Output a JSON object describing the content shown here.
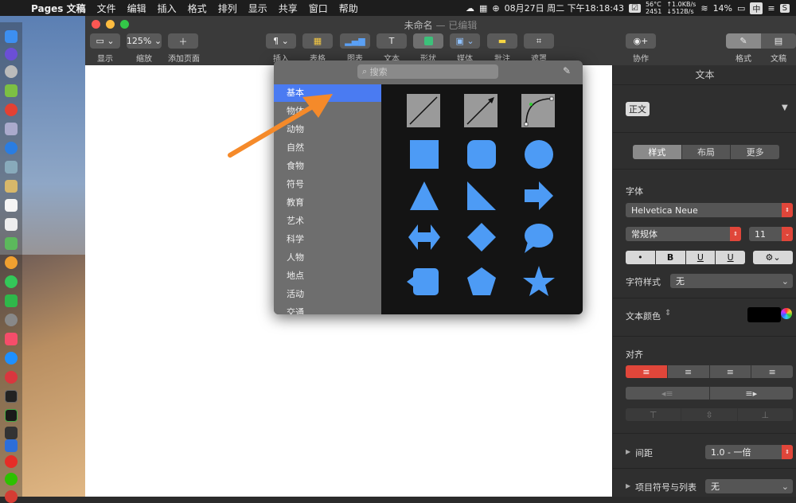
{
  "menubar": {
    "app_name": "Pages 文稿",
    "menus": [
      "文件",
      "编辑",
      "插入",
      "格式",
      "排列",
      "显示",
      "共享",
      "窗口",
      "帮助"
    ],
    "datetime": "08月27日 周二 下午18:18:43",
    "cpu_temp": "56°C",
    "fan": "2451",
    "net_up": "↑1.0KB/s",
    "net_down": "↓512B/s",
    "battery": "14%",
    "input_method": "中"
  },
  "window": {
    "title": "未命名",
    "subtitle": "— 已编辑",
    "traffic_colors": [
      "#fc5753",
      "#fdbc40",
      "#33c748"
    ]
  },
  "toolbar": {
    "view_label": "显示",
    "zoom_value": "125%",
    "zoom_label": "缩放",
    "add_page_label": "添加页面",
    "insert_label": "插入",
    "table_label": "表格",
    "chart_label": "图表",
    "text_label": "文本",
    "shape_label": "形状",
    "media_label": "媒体",
    "comment_label": "批注",
    "crop_label": "遮罩",
    "collab_label": "协作",
    "format_label": "格式",
    "document_label": "文稿"
  },
  "popover": {
    "search_placeholder": "搜索",
    "categories": [
      "基本",
      "物体",
      "动物",
      "自然",
      "食物",
      "符号",
      "教育",
      "艺术",
      "科学",
      "人物",
      "地点",
      "活动",
      "交通"
    ],
    "selected_index": 0,
    "shape_color": "#4d9bf5"
  },
  "inspector": {
    "header": "文本",
    "para_style": "正文",
    "tabs": [
      "样式",
      "布局",
      "更多"
    ],
    "font_section": "字体",
    "font_name": "Helvetica Neue",
    "font_weight": "常规体",
    "font_size": "11",
    "style_buttons": [
      "•",
      "B",
      "U",
      "U"
    ],
    "char_style_label": "字符样式",
    "char_style_value": "无",
    "text_color_label": "文本颜色",
    "align_section": "对齐",
    "spacing_label": "间距",
    "spacing_value": "1.0 - 一倍",
    "bullets_label": "项目符号与列表",
    "bullets_value": "无",
    "accent_color": "#e0463a"
  }
}
